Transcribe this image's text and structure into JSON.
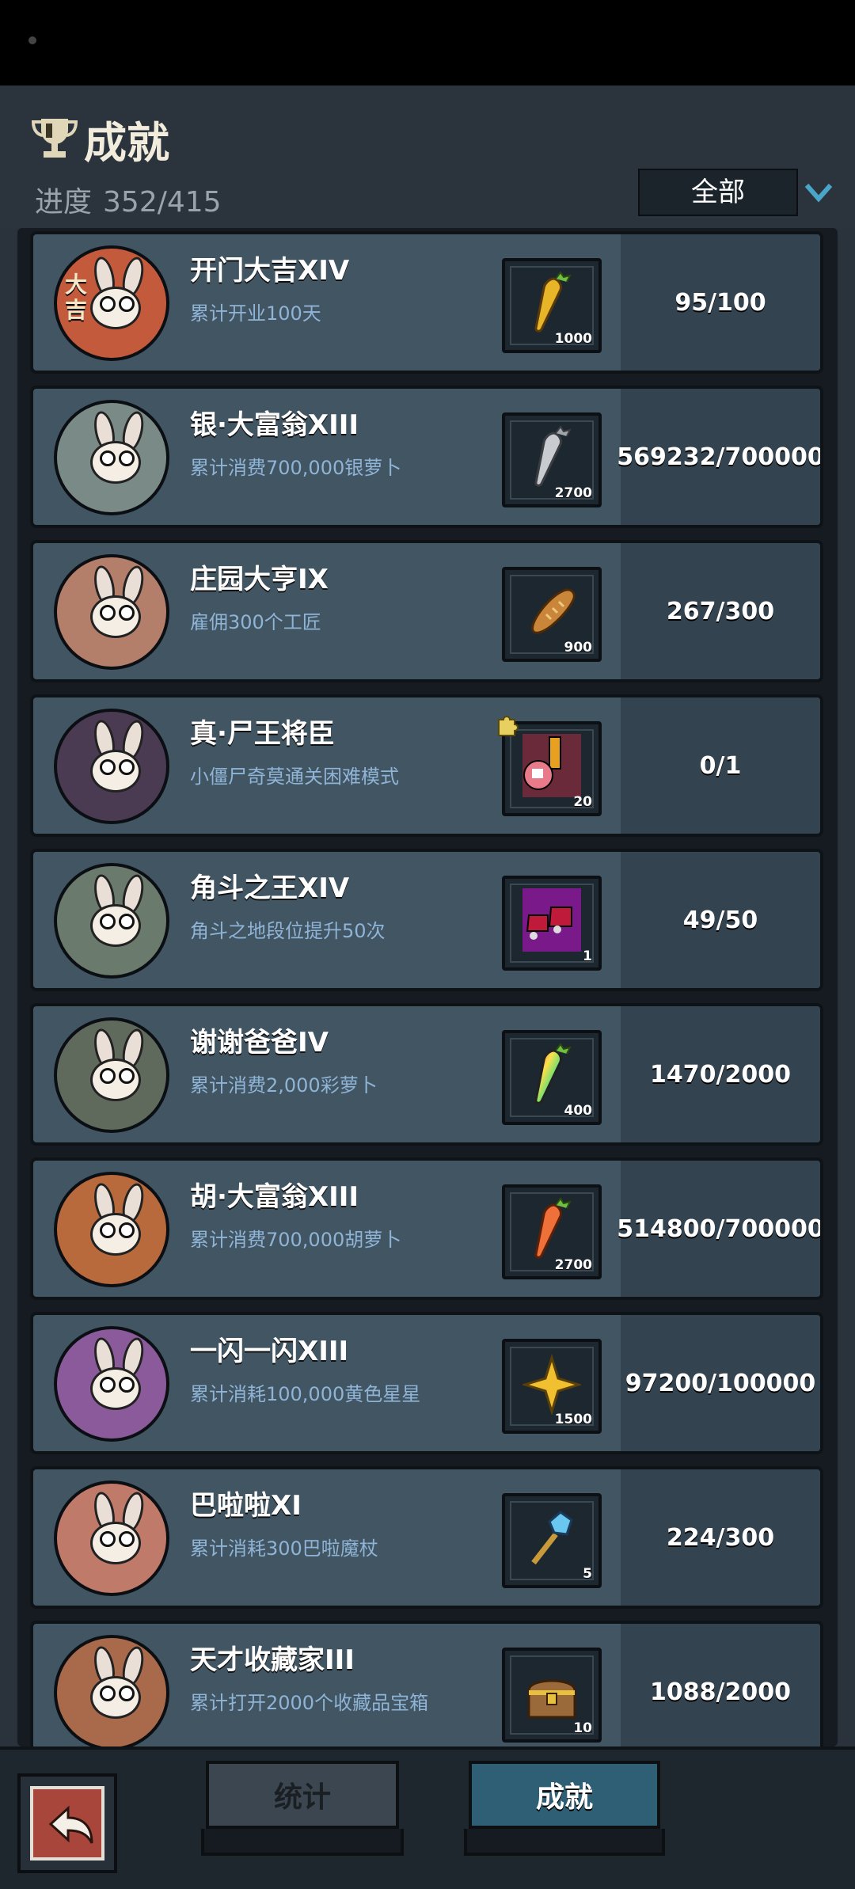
{
  "header": {
    "title": "成就",
    "progress_label": "进度",
    "progress_value": "352/415",
    "filter_value": "全部"
  },
  "achievements": [
    {
      "name": "开门大吉XIV",
      "desc": "累计开业100天",
      "reward_qty": "1000",
      "count": "95/100",
      "reward_icon": "golden-carrot-icon",
      "bg": "#c45a3c",
      "extra": "大吉"
    },
    {
      "name": "银·大富翁XIII",
      "desc": "累计消费700,000银萝卜",
      "reward_qty": "2700",
      "count": "569232/700000",
      "reward_icon": "silver-carrot-icon",
      "bg": "#7a8a86",
      "extra": ""
    },
    {
      "name": "庄园大亨IX",
      "desc": "雇佣300个工匠",
      "reward_qty": "900",
      "count": "267/300",
      "reward_icon": "bread-icon",
      "bg": "#b47f6a",
      "extra": ""
    },
    {
      "name": "真·尸王将臣",
      "desc": "小僵尸奇莫通关困难模式",
      "reward_qty": "20",
      "count": "0/1",
      "reward_icon": "zombie-portrait-icon",
      "bg": "#4a3a52",
      "extra": ""
    },
    {
      "name": "角斗之王XIV",
      "desc": "角斗之地段位提升50次",
      "reward_qty": "1",
      "count": "49/50",
      "reward_icon": "boots-icon",
      "bg": "#6a7a6c",
      "extra": ""
    },
    {
      "name": "谢谢爸爸IV",
      "desc": "累计消费2,000彩萝卜",
      "reward_qty": "400",
      "count": "1470/2000",
      "reward_icon": "rainbow-carrot-icon",
      "bg": "#5f6a5c",
      "extra": ""
    },
    {
      "name": "胡·大富翁XIII",
      "desc": "累计消费700,000胡萝卜",
      "reward_qty": "2700",
      "count": "514800/700000",
      "reward_icon": "carrot-icon",
      "bg": "#b86a3c",
      "extra": ""
    },
    {
      "name": "一闪一闪XIII",
      "desc": "累计消耗100,000黄色星星",
      "reward_qty": "1500",
      "count": "97200/100000",
      "reward_icon": "star-icon",
      "bg": "#8a5a9a",
      "extra": ""
    },
    {
      "name": "巴啦啦XI",
      "desc": "累计消耗300巴啦魔杖",
      "reward_qty": "5",
      "count": "224/300",
      "reward_icon": "magic-wand-icon",
      "bg": "#c07a6a",
      "extra": ""
    },
    {
      "name": "天才收藏家III",
      "desc": "累计打开2000个收藏品宝箱",
      "reward_qty": "10",
      "count": "1088/2000",
      "reward_icon": "treasure-chest-icon",
      "bg": "#a86a4a",
      "extra": ""
    }
  ],
  "tabs": {
    "stats": "统计",
    "achievements": "成就"
  }
}
